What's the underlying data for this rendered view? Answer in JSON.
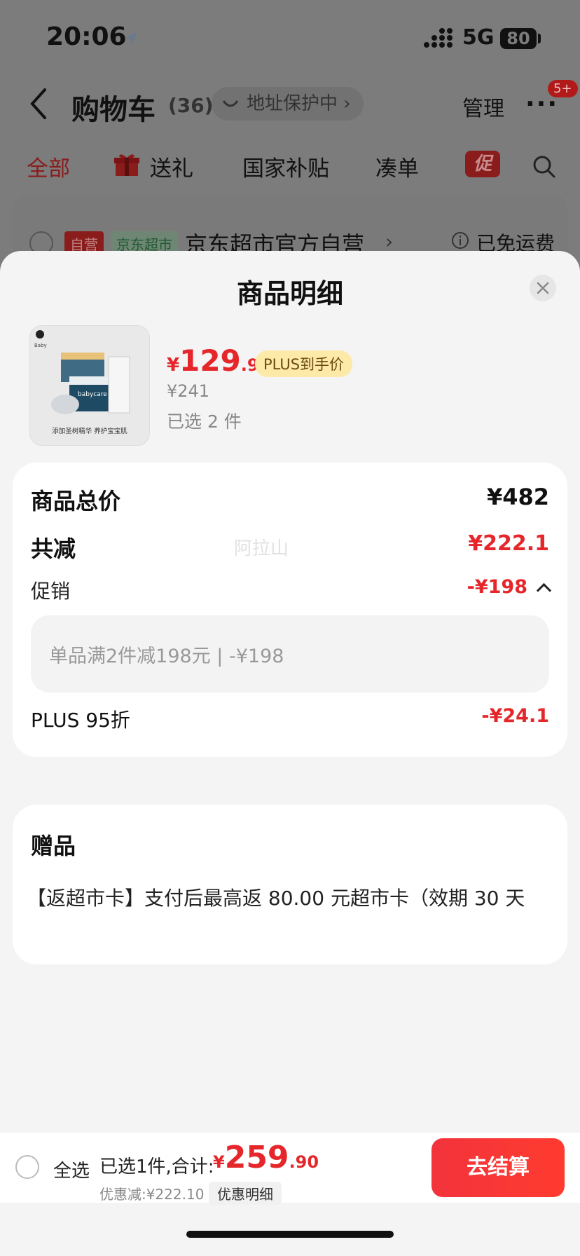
{
  "status_bar": {
    "time": "20:06",
    "network": "5G",
    "battery": "80"
  },
  "nav": {
    "title": "购物车",
    "count": "(36)",
    "address": "地址保护中 ›",
    "manage": "管理",
    "more": "···",
    "badge": "5+"
  },
  "tabs": [
    {
      "label": "全部",
      "active": true
    },
    {
      "label": "送礼"
    },
    {
      "label": "国家补贴"
    },
    {
      "label": "凑单"
    },
    {
      "label": "促"
    }
  ],
  "shop": {
    "tag_self": "自营",
    "tag_market": "京东超市",
    "name": "京东超市官方自营",
    "chevron": "›",
    "shipping": "已免运费"
  },
  "sheet": {
    "title": "商品明细",
    "product": {
      "thumb_text": "添加圣树精华 养护宝宝肌",
      "thumb_brand": "babycare",
      "price_currency": "¥",
      "price_int": "129",
      "price_dec": ".95",
      "plus_tag": "PLUS到手价",
      "original_price": "¥241",
      "selected": "已选 2 件"
    },
    "summary": {
      "total_label": "商品总价",
      "total_value": "¥482",
      "discount_label": "共减",
      "discount_value": "¥222.1",
      "promo_label": "促销",
      "promo_value": "-¥198",
      "promo_detail": "单品满2件减198元 | -¥198",
      "plus_label": "PLUS 95折",
      "plus_value": "-¥24.1",
      "watermark": "阿拉山"
    },
    "gift": {
      "title": "赠品",
      "text": "【返超市卡】支付后最高返 80.00 元超市卡（效期 30 天"
    }
  },
  "bottom_bar": {
    "select_all": "全选",
    "selected_label": "已选1件,合计:",
    "price_currency": "¥",
    "price_int": "259",
    "price_dec": ".90",
    "discount": "优惠减:¥222.10",
    "detail_btn": "优惠明细",
    "checkout": "去结算"
  },
  "colors": {
    "accent_red": "#e5262a",
    "plus_gold": "#fde9a8",
    "sheet_bg": "#f4f4f4"
  }
}
